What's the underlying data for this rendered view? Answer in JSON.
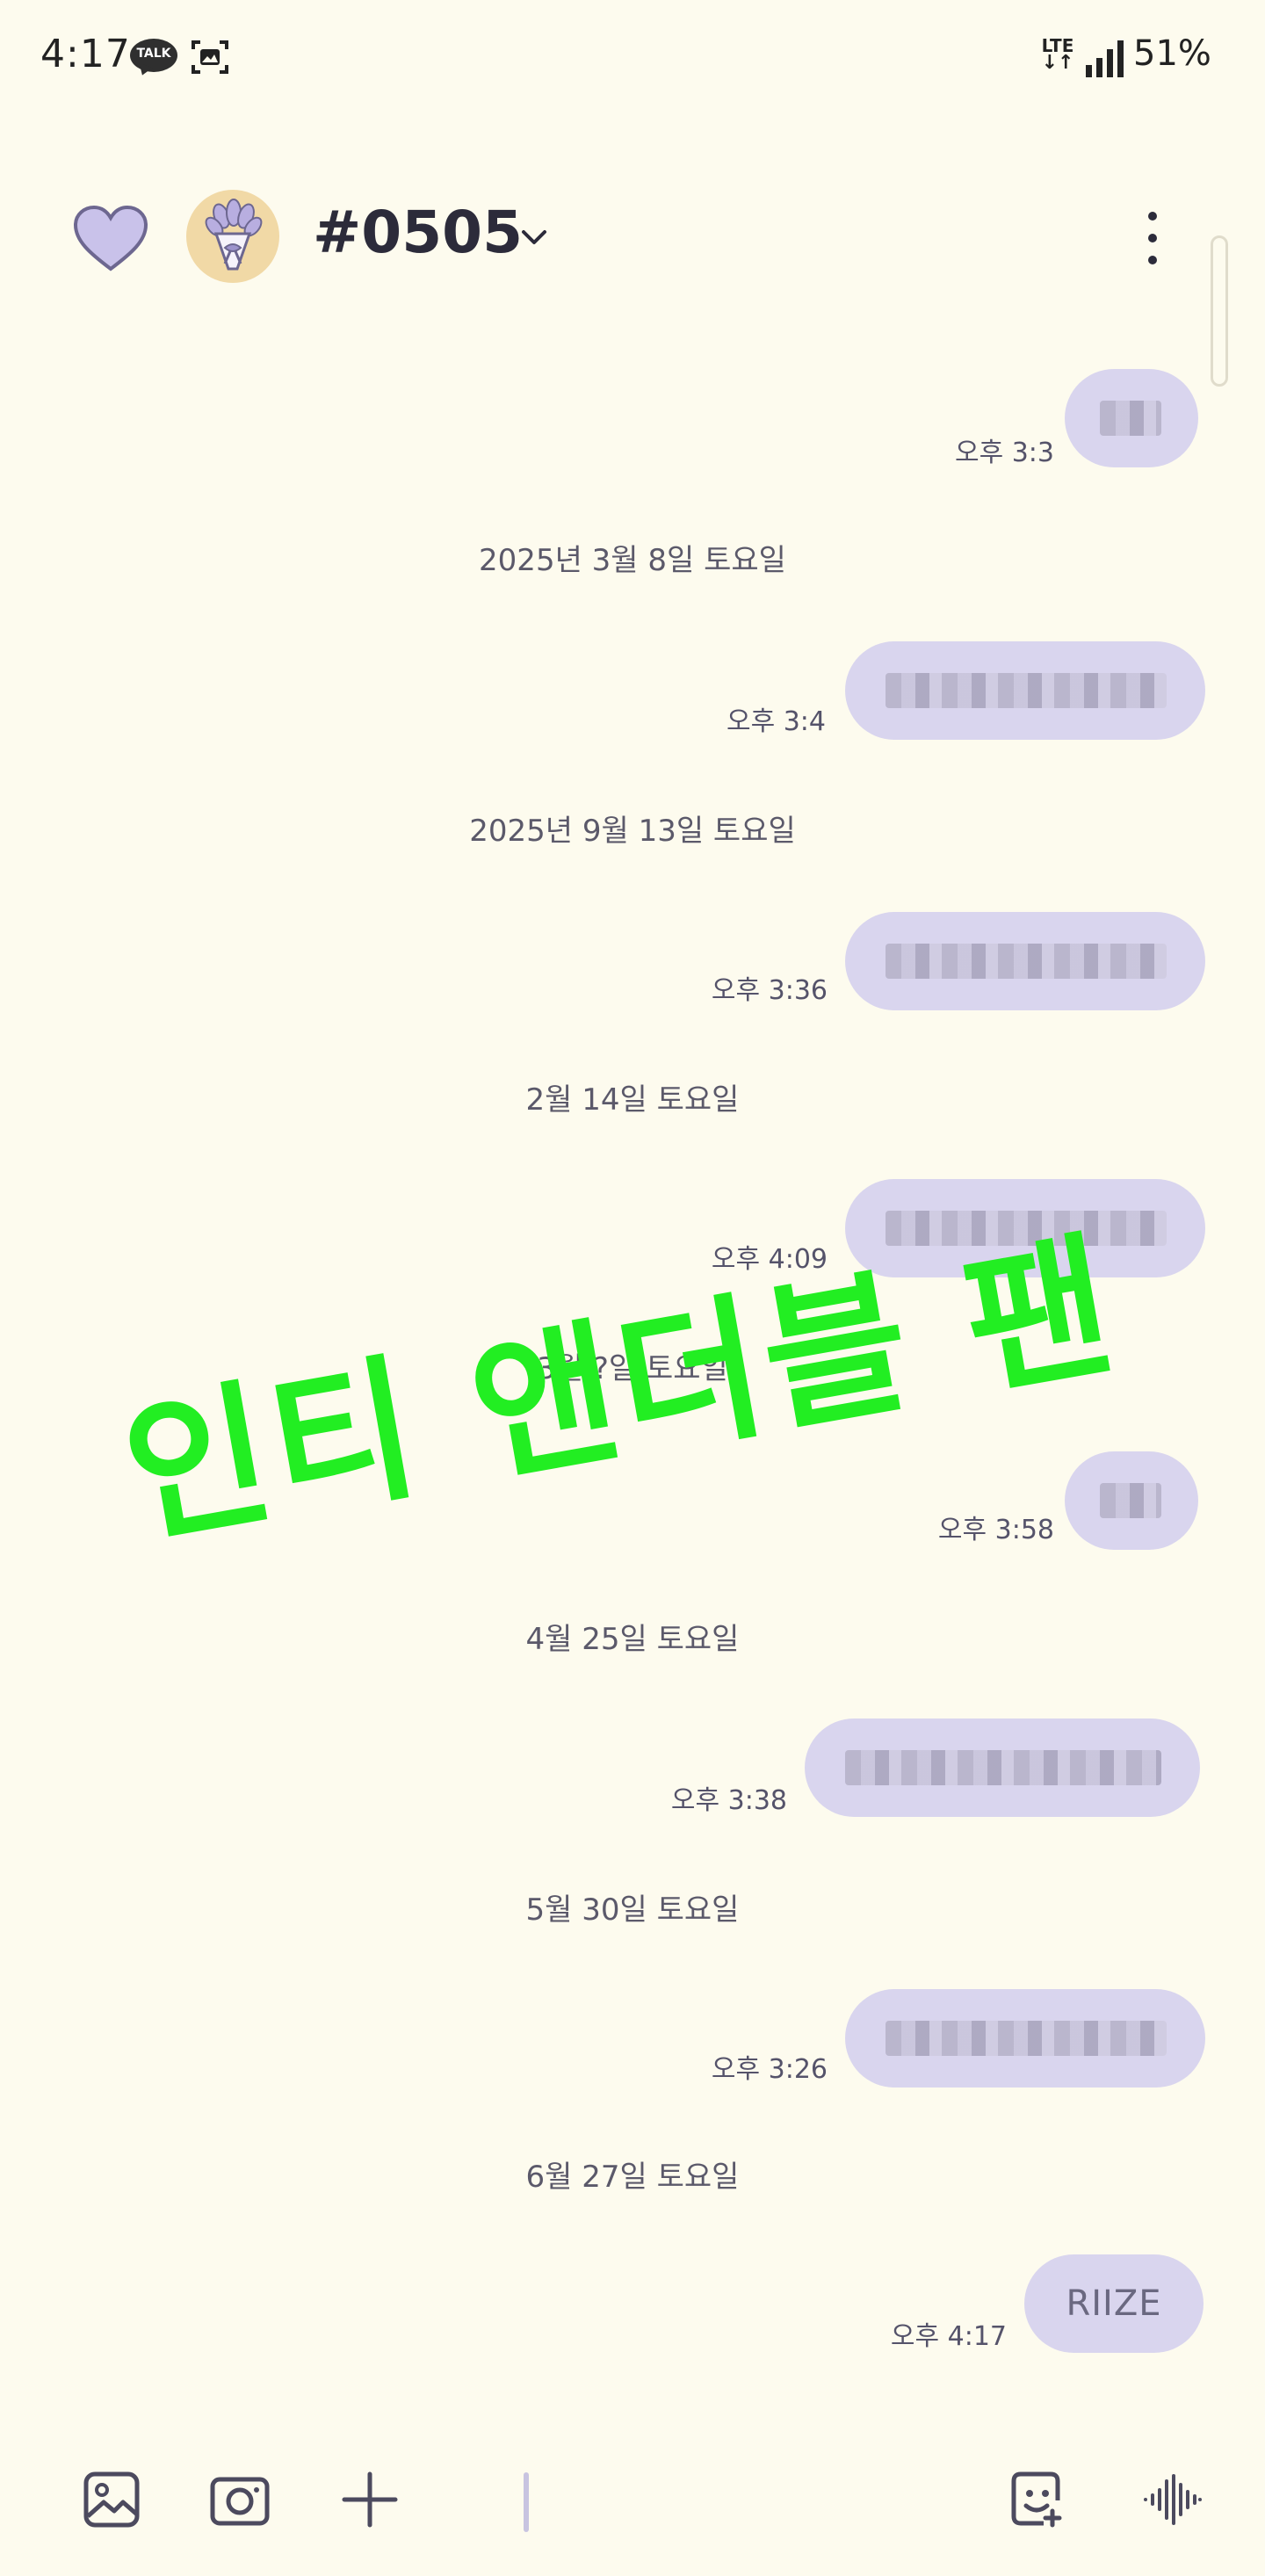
{
  "status_bar": {
    "time": "4:17",
    "talk_badge": "TALK",
    "network": "LTE",
    "battery": "51%"
  },
  "header": {
    "room_title": "#0505",
    "accent": "#c9c2ea"
  },
  "messages": [
    {
      "date": null,
      "time": "오후 3:3",
      "text": ""
    },
    {
      "date": "2025년 3월 8일 토요일",
      "time": "오후 3:4",
      "text": ""
    },
    {
      "date": "2025년 9월 13일 토요일",
      "time": "오후 3:36",
      "text": ""
    },
    {
      "date": "2월 14일 토요일",
      "time": "오후 4:09",
      "text": ""
    },
    {
      "date": "3월 ?일 토요일",
      "time": "오후 3:58",
      "text": ""
    },
    {
      "date": "4월 25일 토요일",
      "time": "오후 3:38",
      "text": ""
    },
    {
      "date": "5월 30일 토요일",
      "time": "오후 3:26",
      "text": ""
    },
    {
      "date": "6월 27일 토요일",
      "time": "오후 4:17",
      "text": "RIIZE"
    }
  ],
  "overlay": {
    "text": "인티 앤더블 팬",
    "color": "#22ee22"
  },
  "bottom_bar": {
    "icons": [
      "gallery-icon",
      "camera-icon",
      "plus-icon",
      "emoticon-icon",
      "voice-icon"
    ]
  }
}
